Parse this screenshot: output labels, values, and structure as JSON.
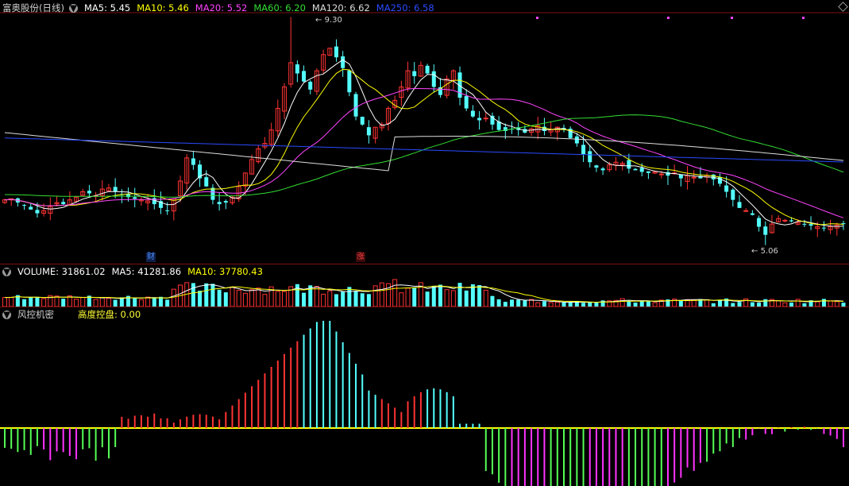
{
  "price_panel": {
    "stock_name": "富奥股份(日线)",
    "indicators": [
      {
        "label": "MA5: 5.45",
        "color": "#ffffff"
      },
      {
        "label": "MA10: 5.46",
        "color": "#ffff00"
      },
      {
        "label": "MA20: 5.52",
        "color": "#ff44ff"
      },
      {
        "label": "MA60: 6.20",
        "color": "#33dd33"
      },
      {
        "label": "MA120: 6.62",
        "color": "#dddddd"
      },
      {
        "label": "MA250: 6.58",
        "color": "#2b4bff"
      }
    ],
    "high_label": "9.30",
    "low_label": "5.06",
    "markers": [
      {
        "text": "财",
        "color": "#4a8cff"
      },
      {
        "text": "涨",
        "color": "#ff4040"
      }
    ]
  },
  "volume_panel": {
    "indicators": [
      {
        "label": "VOLUME: 31861.02",
        "color": "#ffffff"
      },
      {
        "label": "MA5: 41281.86",
        "color": "#ffffff"
      },
      {
        "label": "MA10: 37780.43",
        "color": "#ffff00"
      }
    ]
  },
  "risk_panel": {
    "title": "风控机密",
    "indicator": {
      "label": "高度控盘: 0.00",
      "color": "#ffff33"
    }
  },
  "colors": {
    "up": "#ff3333",
    "down": "#54ffff",
    "ma5": "#ffffff",
    "ma10": "#ffff00",
    "ma20": "#ff44ff",
    "ma60": "#33dd33",
    "ma120": "#dddddd",
    "ma250": "#2b4bff",
    "hist_neg_green": "#55ff55",
    "hist_neg_magenta": "#ff33ff",
    "grid_red": "#7a1010"
  },
  "chart_data": {
    "type": "candlestick",
    "price_range": [
      4.95,
      9.35
    ],
    "high": 9.3,
    "low": 5.06,
    "ma_last": {
      "MA5": 5.45,
      "MA10": 5.46,
      "MA20": 5.52,
      "MA60": 6.2,
      "MA120": 6.62,
      "MA250": 6.58
    },
    "volume_last": 31861.02,
    "volume_ma5": 41281.86,
    "volume_ma10": 37780.43,
    "risk_value": 0.0,
    "closes": [
      5.9,
      5.92,
      5.85,
      5.8,
      5.72,
      5.65,
      5.7,
      5.78,
      5.85,
      5.82,
      5.9,
      5.95,
      6.05,
      6.02,
      5.98,
      6.1,
      6.12,
      6.05,
      6.0,
      5.95,
      5.92,
      5.9,
      5.88,
      5.82,
      5.75,
      5.7,
      5.92,
      6.25,
      6.68,
      6.55,
      6.3,
      6.15,
      5.9,
      5.82,
      5.85,
      5.95,
      6.15,
      6.4,
      6.65,
      6.85,
      6.95,
      7.2,
      7.6,
      8.0,
      8.45,
      8.25,
      8.1,
      7.95,
      8.3,
      8.6,
      8.72,
      8.55,
      8.35,
      7.9,
      7.45,
      7.3,
      7.1,
      7.25,
      7.3,
      7.6,
      7.75,
      8.0,
      8.3,
      8.2,
      8.4,
      8.25,
      8.0,
      7.85,
      8.15,
      8.3,
      7.8,
      7.6,
      7.45,
      7.38,
      7.42,
      7.3,
      7.2,
      7.18,
      7.22,
      7.2,
      7.15,
      7.22,
      7.28,
      7.18,
      7.2,
      7.25,
      7.2,
      7.05,
      6.95,
      6.75,
      6.6,
      6.5,
      6.45,
      6.55,
      6.6,
      6.58,
      6.48,
      6.45,
      6.42,
      6.4,
      6.42,
      6.38,
      6.35,
      6.4,
      6.3,
      6.35,
      6.32,
      6.3,
      6.35,
      6.28,
      6.2,
      6.05,
      5.9,
      5.75,
      5.7,
      5.62,
      5.4,
      5.25,
      5.45,
      5.55,
      5.52,
      5.5,
      5.48,
      5.45,
      5.42,
      5.4,
      5.38,
      5.4,
      5.43,
      5.45
    ]
  }
}
